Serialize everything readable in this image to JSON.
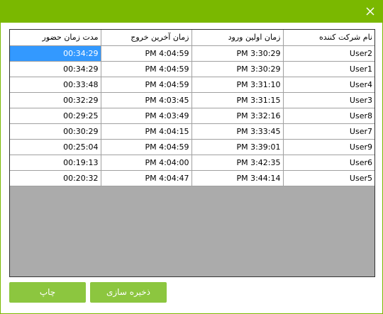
{
  "window": {
    "accent_color": "#7ab800",
    "button_color": "#8cc63f",
    "close_icon": "close-icon"
  },
  "table": {
    "columns": [
      "مدت زمان حضور",
      "زمان آخرین خروج",
      "زمان اولین ورود",
      "نام شرکت کننده"
    ],
    "rows": [
      [
        "00:34:29",
        "PM 4:04:59",
        "PM 3:30:29",
        "User2"
      ],
      [
        "00:34:29",
        "PM 4:04:59",
        "PM 3:30:29",
        "User1"
      ],
      [
        "00:33:48",
        "PM 4:04:59",
        "PM 3:31:10",
        "User4"
      ],
      [
        "00:32:29",
        "PM 4:03:45",
        "PM 3:31:15",
        "User3"
      ],
      [
        "00:29:25",
        "PM 4:03:49",
        "PM 3:32:16",
        "User8"
      ],
      [
        "00:30:29",
        "PM 4:04:15",
        "PM 3:33:45",
        "User7"
      ],
      [
        "00:25:04",
        "PM 4:04:59",
        "PM 3:39:01",
        "User9"
      ],
      [
        "00:19:13",
        "PM 4:04:00",
        "PM 3:42:35",
        "User6"
      ],
      [
        "00:20:32",
        "PM 4:04:47",
        "PM 3:44:14",
        "User5"
      ]
    ]
  },
  "footer": {
    "print_label": "چاپ",
    "save_label": "ذخیره سازی"
  }
}
